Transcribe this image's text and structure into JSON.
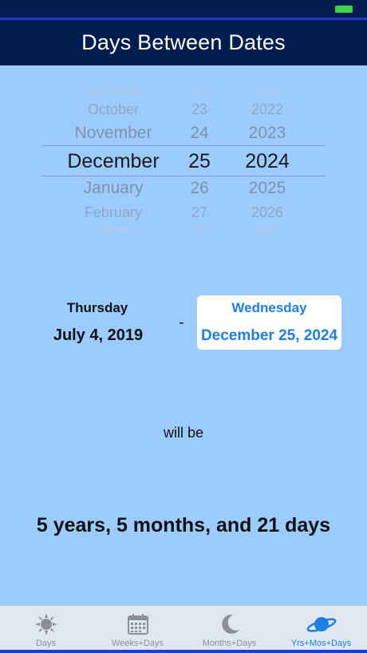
{
  "app": {
    "title": "Days Between Dates"
  },
  "picker": {
    "rows": [
      {
        "month": "September",
        "day": "22",
        "year": "2021"
      },
      {
        "month": "October",
        "day": "23",
        "year": "2022"
      },
      {
        "month": "November",
        "day": "24",
        "year": "2023"
      },
      {
        "month": "December",
        "day": "25",
        "year": "2024"
      },
      {
        "month": "January",
        "day": "26",
        "year": "2025"
      },
      {
        "month": "February",
        "day": "27",
        "year": "2026"
      },
      {
        "month": "March",
        "day": "28",
        "year": "2027"
      }
    ]
  },
  "start": {
    "weekday": "Thursday",
    "date": "July 4, 2019"
  },
  "separator": "-",
  "end": {
    "weekday": "Wednesday",
    "date": "December 25, 2024"
  },
  "connector": "will be",
  "result": "5 years, 5 months, and 21 days",
  "tabs": [
    {
      "label": "Days",
      "icon": "sun-icon"
    },
    {
      "label": "Weeks+Days",
      "icon": "calendar-icon"
    },
    {
      "label": "Months+Days",
      "icon": "moon-icon"
    },
    {
      "label": "Yrs+Mos+Days",
      "icon": "planet-icon"
    }
  ],
  "colors": {
    "accent": "#1f7fe0",
    "navbar": "#001d4f",
    "background": "#9cccff"
  }
}
